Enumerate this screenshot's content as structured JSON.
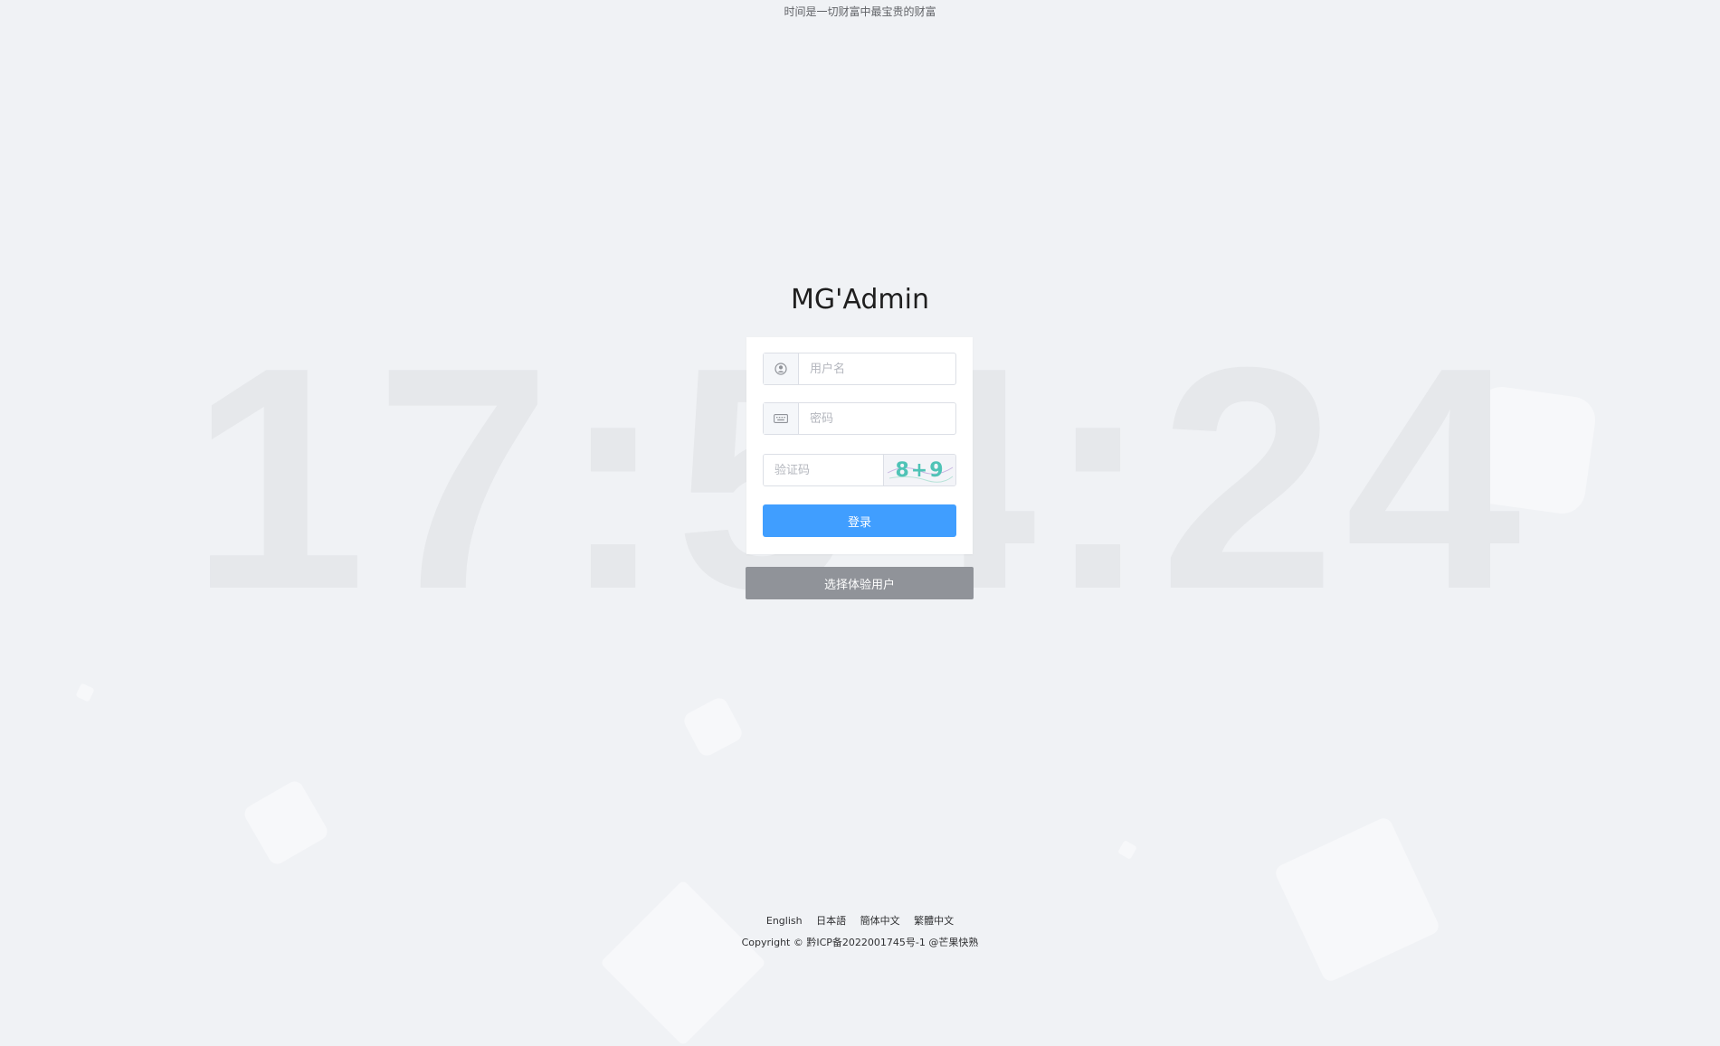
{
  "motto": "时间是一切财富中最宝贵的财富",
  "clock": "17:54:24",
  "app_title": "MG'Admin",
  "login": {
    "username_placeholder": "用户名",
    "password_placeholder": "密码",
    "captcha_placeholder": "验证码",
    "captcha_text": "8+9",
    "submit_label": "登录"
  },
  "demo_user_label": "选择体验用户",
  "languages": [
    "English",
    "日本語",
    "簡体中文",
    "繁體中文"
  ],
  "copyright": "Copyright © 黔ICP备2022001745号-1 @芒果快熟",
  "colors": {
    "background": "#f0f2f5",
    "primary": "#409eff",
    "demo_button": "#909399"
  },
  "icons": {
    "username": "user-circle-icon",
    "password": "keyboard-icon"
  }
}
